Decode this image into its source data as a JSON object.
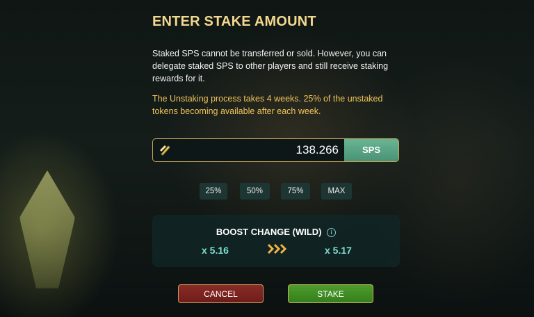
{
  "dialog": {
    "title": "ENTER STAKE AMOUNT",
    "description": "Staked SPS cannot be transferred or sold. However, you can delegate staked SPS to other players and still receive staking rewards for it.",
    "warning": "The Unstaking process takes 4 weeks. 25% of the unstaked tokens becoming available after each week."
  },
  "stake_input": {
    "value": "138.266",
    "unit": "SPS",
    "icon": "sps-token-icon"
  },
  "percent_buttons": [
    "25%",
    "50%",
    "75%",
    "MAX"
  ],
  "boost": {
    "title": "BOOST CHANGE (WILD)",
    "info_icon": "i",
    "current": "x 5.16",
    "new": "x 5.17"
  },
  "actions": {
    "cancel_label": "CANCEL",
    "stake_label": "STAKE"
  },
  "colors": {
    "title": "#f3d88f",
    "warning": "#f0c35a",
    "unit_badge": "#5aa585",
    "boost_value": "#7de0d2",
    "arrows": "#f2b544",
    "cancel": "#7a2421",
    "stake": "#41902a"
  }
}
